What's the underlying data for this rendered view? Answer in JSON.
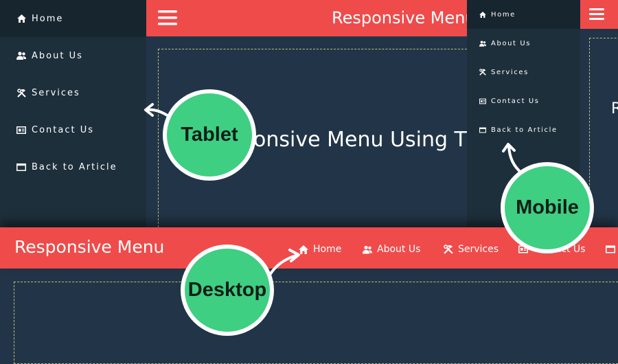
{
  "tablet": {
    "title": "Responsive Menu",
    "heading": "ponsive Menu Using T",
    "menu": [
      {
        "label": "Home",
        "icon": "home-icon"
      },
      {
        "label": "About Us",
        "icon": "users-icon"
      },
      {
        "label": "Services",
        "icon": "tools-icon"
      },
      {
        "label": "Contact Us",
        "icon": "contact-card-icon"
      },
      {
        "label": "Back to Article",
        "icon": "window-icon"
      }
    ],
    "badge": "Tablet"
  },
  "mobile": {
    "menu": [
      {
        "label": "Home",
        "icon": "home-icon"
      },
      {
        "label": "About Us",
        "icon": "users-icon"
      },
      {
        "label": "Services",
        "icon": "tools-icon"
      },
      {
        "label": "Contact Us",
        "icon": "contact-card-icon"
      },
      {
        "label": "Back to Article",
        "icon": "window-icon"
      }
    ],
    "content_fragment": "R",
    "badge": "Mobile"
  },
  "desktop": {
    "title": "Responsive Menu",
    "nav": [
      {
        "label": "Home",
        "icon": "home-icon"
      },
      {
        "label": "About Us",
        "icon": "users-icon"
      },
      {
        "label": "Services",
        "icon": "tools-icon"
      },
      {
        "label": "Contact Us",
        "icon": "contact-card-icon"
      },
      {
        "label": "",
        "icon": "window-icon"
      }
    ],
    "badge": "Desktop"
  },
  "colors": {
    "accent": "#ef4b4b",
    "sidebar": "#1e2f3c",
    "sidebar_active": "#17252f",
    "content_bg": "#223548",
    "badge_green": "#3ecf82"
  }
}
